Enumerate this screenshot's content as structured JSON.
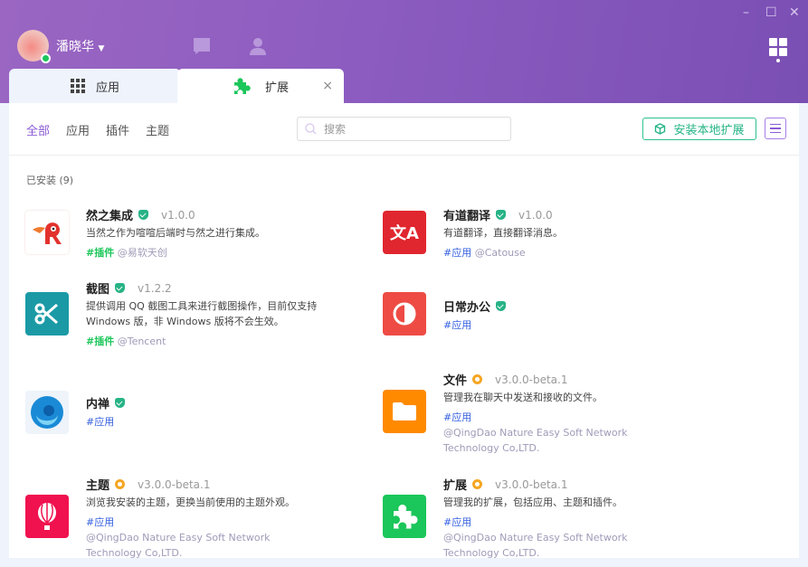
{
  "window": {
    "controls": [
      "–",
      "☐",
      "✕"
    ]
  },
  "user": {
    "name": "潘晓华",
    "status_color": "#1bc65a"
  },
  "tabs": [
    {
      "label": "应用"
    },
    {
      "label": "扩展",
      "close": "×"
    }
  ],
  "filters": [
    "全部",
    "应用",
    "插件",
    "主题"
  ],
  "search": {
    "placeholder": "搜索"
  },
  "install_label": "安装本地扩展",
  "section_label": "已安装 (9)",
  "items": [
    {
      "name": "然之集成",
      "version": "v1.0.0",
      "status": "verified",
      "desc": "当然之作为喧喧后端时与然之进行集成。",
      "tag": "#插件",
      "author": "@易软天创"
    },
    {
      "name": "截图",
      "version": "v1.2.2",
      "status": "verified",
      "desc": "提供调用 QQ 截图工具来进行截图操作，目前仅支持 Windows 版，非 Windows 版将不会生效。",
      "tag": "#插件",
      "author": "@Tencent"
    },
    {
      "name": "内禅",
      "version": "",
      "status": "verified",
      "desc": "",
      "tag": "#应用",
      "author": ""
    },
    {
      "name": "主题",
      "version": "v3.0.0-beta.1",
      "status": "builtin",
      "desc": "浏览我安装的主题，更换当前使用的主题外观。",
      "tag": "#应用",
      "author": "@QingDao Nature Easy Soft Network Technology Co,LTD."
    },
    {
      "name": "有道翻译",
      "version": "v1.0.0",
      "status": "verified",
      "desc": "有道翻译，直接翻译消息。",
      "tag": "#应用",
      "author": "@Catouse"
    },
    {
      "name": "日常办公",
      "version": "",
      "status": "verified",
      "desc": "",
      "tag": "#应用",
      "author": ""
    },
    {
      "name": "文件",
      "version": "v3.0.0-beta.1",
      "status": "builtin",
      "desc": "管理我在聊天中发送和接收的文件。",
      "tag": "#应用",
      "author": "@QingDao Nature Easy Soft Network Technology Co,LTD."
    },
    {
      "name": "扩展",
      "version": "v3.0.0-beta.1",
      "status": "builtin",
      "desc": "管理我的扩展，包括应用、主题和插件。",
      "tag": "#应用",
      "author": "@QingDao Nature Easy Soft Network Technology Co,LTD."
    }
  ]
}
